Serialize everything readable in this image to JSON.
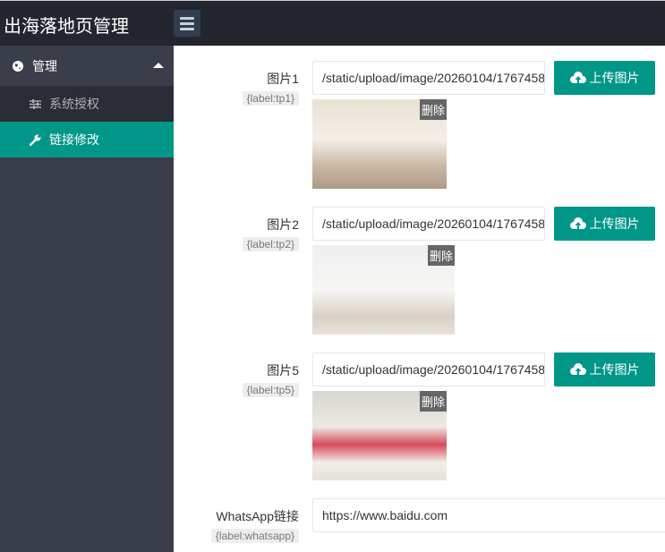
{
  "header": {
    "title": "出海落地页管理",
    "menu_toggle": "menu-toggle"
  },
  "sidebar": {
    "group": {
      "label": "管理",
      "icon": "globe-icon"
    },
    "items": [
      {
        "label": "系统授权",
        "icon": "sliders-icon",
        "active": false
      },
      {
        "label": "链接修改",
        "icon": "wrench-icon",
        "active": true
      }
    ]
  },
  "form": {
    "upload_label": "上传图片",
    "delete_label": "删除",
    "images": [
      {
        "label": "图片1",
        "tag": "{label:tp1}",
        "value": "/static/upload/image/20260104/1767458"
      },
      {
        "label": "图片2",
        "tag": "{label:tp2}",
        "value": "/static/upload/image/20260104/1767458"
      },
      {
        "label": "图片5",
        "tag": "{label:tp5}",
        "value": "/static/upload/image/20260104/1767458"
      }
    ],
    "whatsapp": {
      "label": "WhatsApp链接",
      "tag": "{label:whatsapp}",
      "value": "https://www.baidu.com"
    }
  },
  "colors": {
    "accent": "#009688",
    "topbar": "#23262e",
    "sidebar": "#393d49"
  }
}
